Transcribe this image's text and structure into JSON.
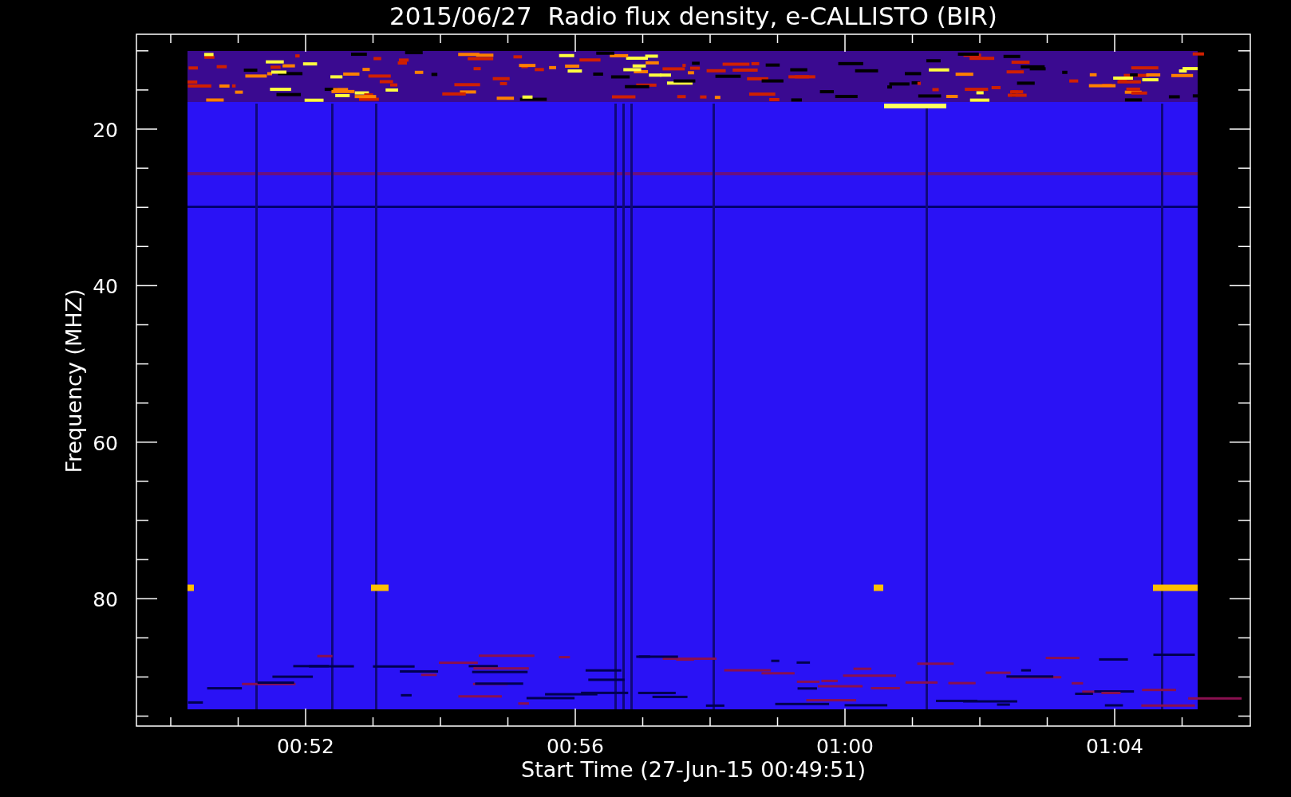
{
  "title": "2015/06/27  Radio flux density, e-CALLISTO (BIR)",
  "ylabel": "Frequency (MHZ)",
  "xlabel": "Start Time (27-Jun-15 00:49:51)",
  "yticks": [
    "20",
    "40",
    "60",
    "80"
  ],
  "xticks": [
    "00:52",
    "00:56",
    "01:00",
    "01:04"
  ]
}
